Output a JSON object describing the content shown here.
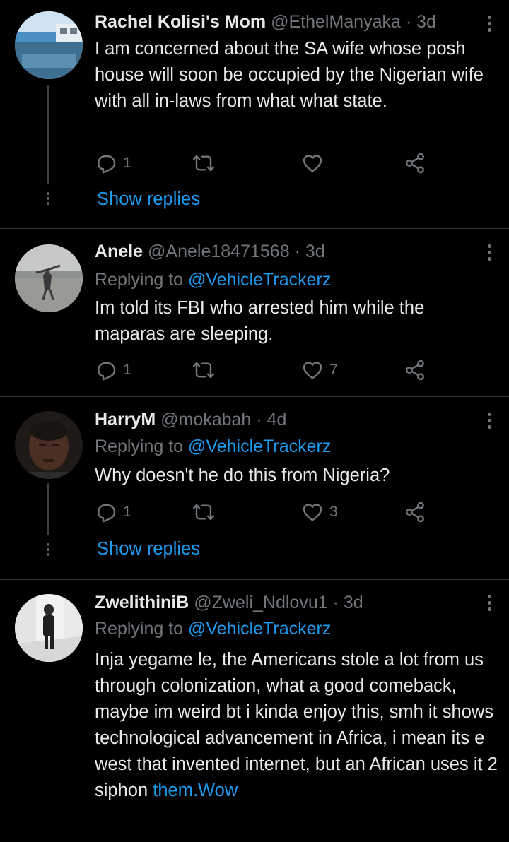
{
  "tweets": [
    {
      "name": "Rachel Kolisi's Mom",
      "handle": "@EthelManyaka",
      "time": "3d",
      "separator": "·",
      "text": "I am concerned about the SA wife whose posh house will soon be occupied by the Nigerian wife with all in-laws from what what state.",
      "reply_count": "1",
      "retweet_count": "",
      "like_count": "",
      "show_replies": "Show replies"
    },
    {
      "name": "Anele",
      "handle": "@Anele18471568",
      "time": "3d",
      "separator": "·",
      "replying_prefix": "Replying to",
      "replying_to": "@VehicleTrackerz",
      "text": "Im told its FBI who arrested him while the maparas are sleeping.",
      "reply_count": "1",
      "retweet_count": "",
      "like_count": "7"
    },
    {
      "name": "HarryM",
      "handle": "@mokabah",
      "time": "4d",
      "separator": "·",
      "replying_prefix": "Replying to",
      "replying_to": "@VehicleTrackerz",
      "text": "Why doesn't he do this from Nigeria?",
      "reply_count": "1",
      "retweet_count": "",
      "like_count": "3",
      "show_replies": "Show replies"
    },
    {
      "name": "ZwelithiniB",
      "handle": "@Zweli_Ndlovu1",
      "time": "3d",
      "separator": "·",
      "replying_prefix": "Replying to",
      "replying_to": "@VehicleTrackerz",
      "text": "Inja yegame le, the Americans stole a lot from us through colonization, what a good comeback, maybe im weird bt i kinda enjoy this, smh it shows technological advancement in Africa, i mean its e west that invented internet, but an African uses it 2 siphon",
      "text_link": "them.Wow"
    }
  ],
  "colors": {
    "background": "#000000",
    "text": "#e7e9ea",
    "muted": "#71767b",
    "link": "#1d9bf0",
    "divider": "#2f3336"
  },
  "icons": [
    "reply-icon",
    "retweet-icon",
    "like-icon",
    "share-icon",
    "more-options-icon"
  ]
}
